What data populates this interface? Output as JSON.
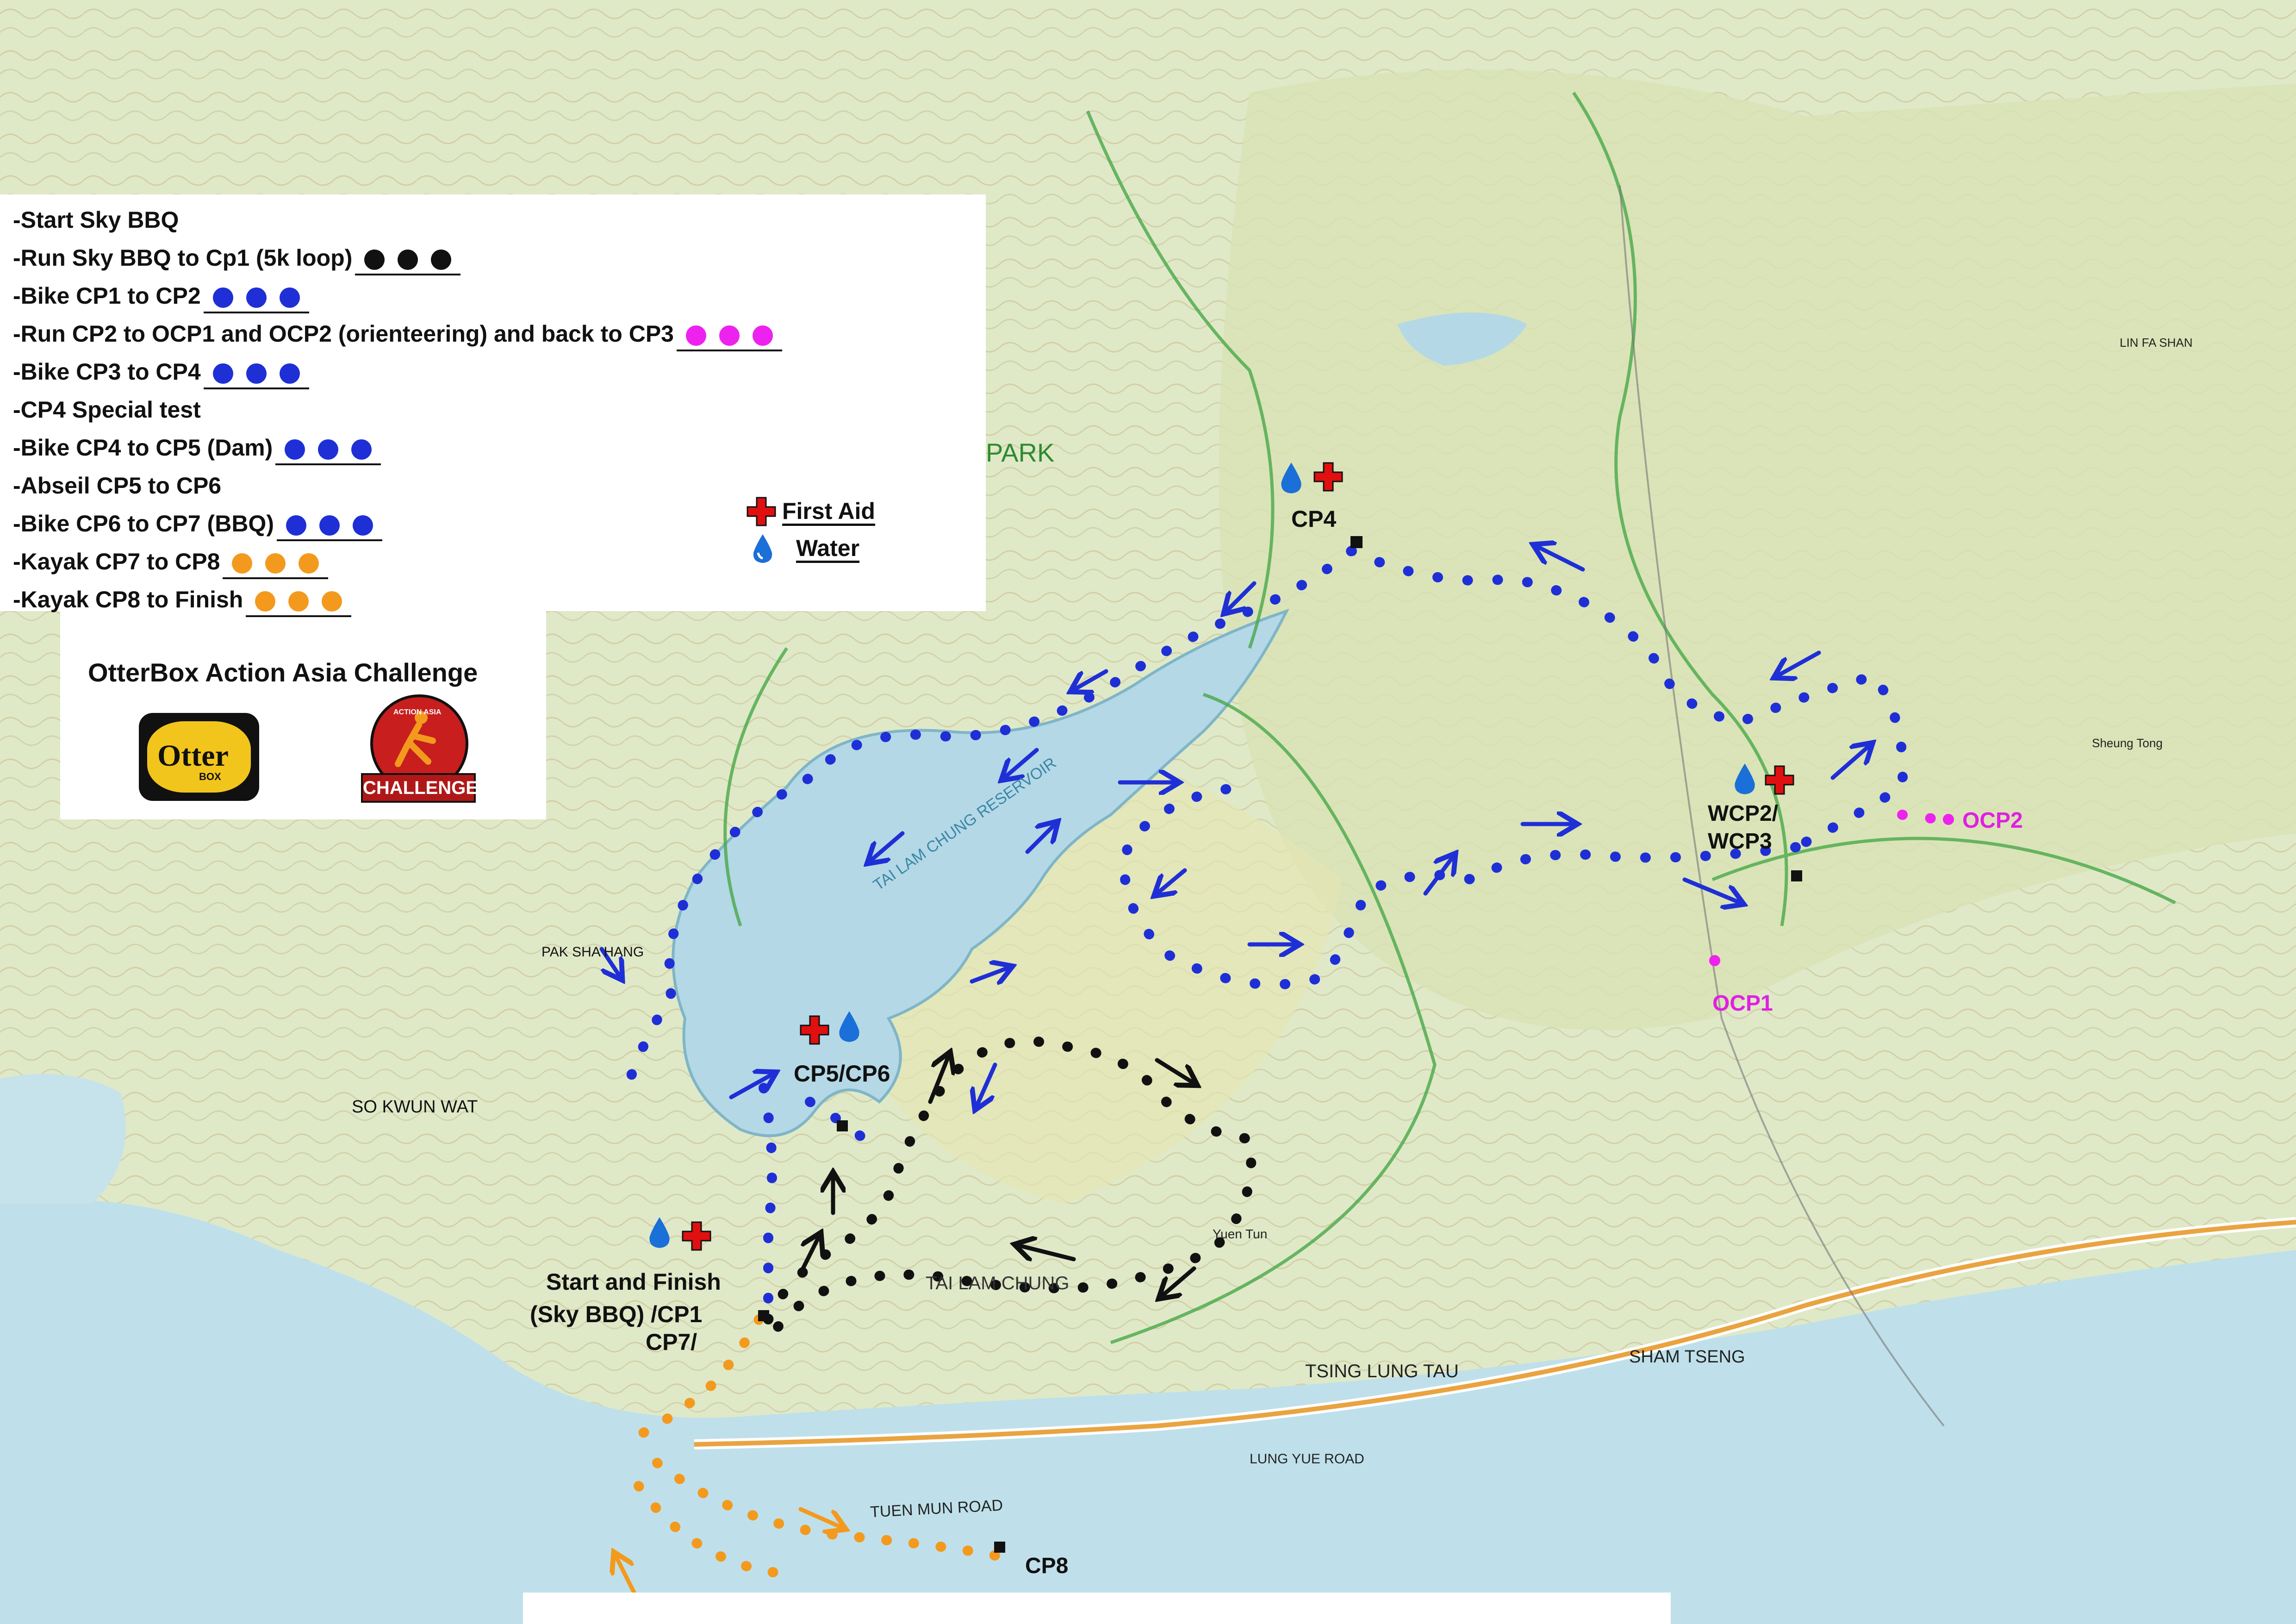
{
  "legend": {
    "items": [
      {
        "text": "-Start Sky BBQ",
        "dots": []
      },
      {
        "text": "-Run Sky BBQ to Cp1 (5k loop)",
        "dots": [
          "#111111",
          "#111111",
          "#111111"
        ]
      },
      {
        "text": "-Bike CP1 to CP2",
        "dots": [
          "#1f2fd6",
          "#1f2fd6",
          "#1f2fd6"
        ]
      },
      {
        "text": "-Run CP2 to OCP1 and OCP2 (orienteering) and back to CP3",
        "dots": [
          "#ee22ee",
          "#ee22ee",
          "#ee22ee"
        ]
      },
      {
        "text": "-Bike CP3 to CP4",
        "dots": [
          "#1f2fd6",
          "#1f2fd6",
          "#1f2fd6"
        ]
      },
      {
        "text": "-CP4 Special test",
        "dots": []
      },
      {
        "text": "-Bike CP4 to CP5 (Dam)",
        "dots": [
          "#1f2fd6",
          "#1f2fd6",
          "#1f2fd6"
        ]
      },
      {
        "text": "-Abseil CP5 to CP6",
        "dots": []
      },
      {
        "text": "-Bike CP6 to CP7 (BBQ)",
        "dots": [
          "#1f2fd6",
          "#1f2fd6",
          "#1f2fd6"
        ]
      },
      {
        "text": "-Kayak CP7 to CP8",
        "dots": [
          "#f39a1e",
          "#f39a1e",
          "#f39a1e"
        ]
      },
      {
        "text": "-Kayak CP8 to Finish",
        "dots": [
          "#f39a1e",
          "#f39a1e",
          "#f39a1e"
        ]
      }
    ],
    "first_aid": "First Aid",
    "water": "Water"
  },
  "event": {
    "title": "OtterBox Action Asia Challenge",
    "sponsor_logo_text": "Otter",
    "sponsor_logo_sub": "BOX",
    "race_logo_text": "CHALLENGE",
    "race_logo_sub": "ACTION ASIA"
  },
  "checkpoints": {
    "cp4": "CP4",
    "cp5_cp6": "CP5/CP6",
    "wcp": [
      "WCP2/",
      "WCP3"
    ],
    "ocp1": "OCP1",
    "ocp2": "OCP2",
    "start": [
      "Start and Finish",
      "(Sky BBQ) /CP1",
      "CP7/"
    ],
    "cp8": "CP8"
  },
  "map_labels": {
    "park": "PARK",
    "reservoir": "TAI LAM CHUNG RESERVOIR",
    "pak_sha_hang": "PAK SHA HANG",
    "so_kwun_wat": "SO KWUN WAT",
    "tai_lam_chung": "TAI LAM CHUNG",
    "tsing_lung_tau": "TSING LUNG TAU",
    "sham_tseng": "SHAM TSENG",
    "tuen_mun_road": "TUEN MUN ROAD",
    "lung_yue_road": "LUNG YUE ROAD",
    "yuen_tun": "Yuen Tun",
    "lin_fa_shan": "LIN FA SHAN",
    "sheung_tong": "Sheung Tong"
  },
  "colors": {
    "water": "#bfe0ea",
    "land": "#dfe9c8",
    "bike": "#1f2fd6",
    "run": "#111111",
    "orienteering": "#ee22ee",
    "kayak": "#f39a1e",
    "first_aid": "#e01010",
    "water_drop": "#1a6fd8"
  },
  "icons": {
    "first_aid": "red-cross-icon",
    "water": "water-drop-icon"
  }
}
